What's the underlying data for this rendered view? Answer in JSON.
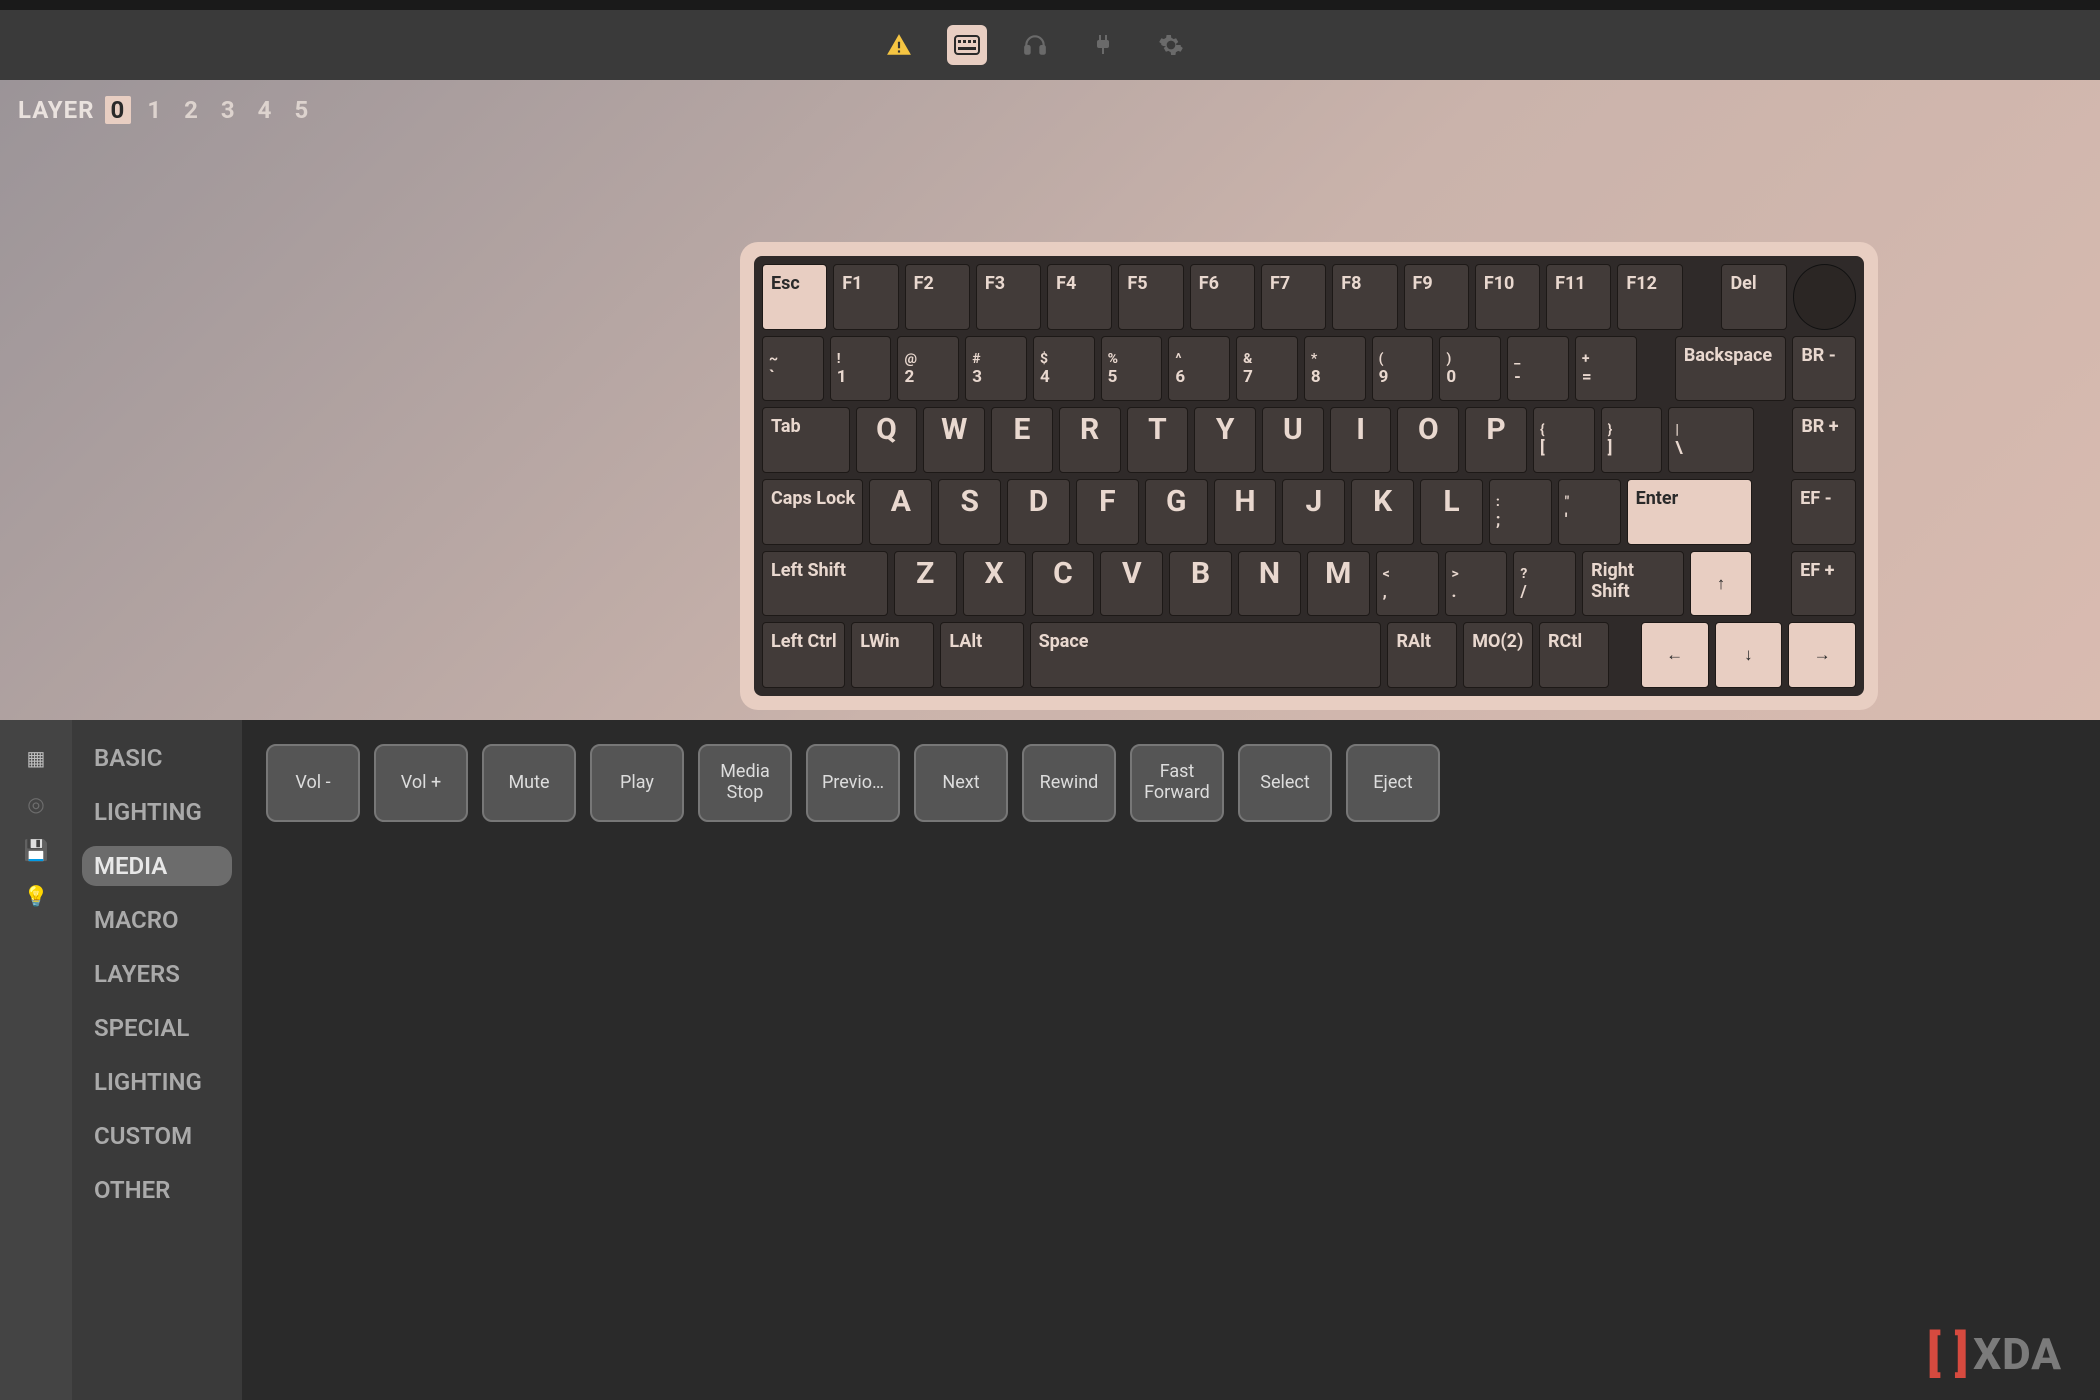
{
  "toolbar_icons": [
    "warning",
    "keyboard",
    "headset",
    "plug",
    "gear"
  ],
  "layer": {
    "label": "LAYER",
    "options": [
      "0",
      "1",
      "2",
      "3",
      "4",
      "5"
    ],
    "active": "0"
  },
  "keyboard": {
    "row0": [
      "Esc",
      "F1",
      "F2",
      "F3",
      "F4",
      "F5",
      "F6",
      "F7",
      "F8",
      "F9",
      "F10",
      "F11",
      "F12",
      "",
      "Del",
      ""
    ],
    "row1": [
      [
        "~",
        "`"
      ],
      [
        "!",
        "1"
      ],
      [
        "@",
        "2"
      ],
      [
        "#",
        "3"
      ],
      [
        "$",
        "4"
      ],
      [
        "%",
        "5"
      ],
      [
        "^",
        "6"
      ],
      [
        "&",
        "7"
      ],
      [
        "*",
        "8"
      ],
      [
        "(",
        "9"
      ],
      [
        ")",
        "0"
      ],
      [
        "_",
        "-"
      ],
      [
        "+",
        "="
      ],
      "Backspace",
      "BR -"
    ],
    "row2": [
      "Tab",
      "Q",
      "W",
      "E",
      "R",
      "T",
      "Y",
      "U",
      "I",
      "O",
      "P",
      [
        "{",
        "["
      ],
      [
        "}",
        "]"
      ],
      [
        "|",
        "\\"
      ],
      "BR +"
    ],
    "row3": [
      "Caps Lock",
      "A",
      "S",
      "D",
      "F",
      "G",
      "H",
      "J",
      "K",
      "L",
      [
        ":",
        ";"
      ],
      [
        "\"",
        "'"
      ],
      "Enter",
      "EF -"
    ],
    "row4": [
      "Left Shift",
      "Z",
      "X",
      "C",
      "V",
      "B",
      "N",
      "M",
      [
        "<",
        ","
      ],
      [
        ">",
        "."
      ],
      [
        "?",
        "/"
      ],
      "Right Shift",
      "↑",
      "EF +"
    ],
    "row5": [
      "Left Ctrl",
      "LWin",
      "LAlt",
      "Space",
      "RAlt",
      "MO(2)",
      "RCtl",
      "←",
      "↓",
      "→"
    ]
  },
  "categories": [
    "BASIC",
    "LIGHTING",
    "MEDIA",
    "MACRO",
    "LAYERS",
    "SPECIAL",
    "LIGHTING",
    "CUSTOM",
    "OTHER"
  ],
  "active_category": "MEDIA",
  "media_keys": [
    "Vol -",
    "Vol +",
    "Mute",
    "Play",
    "Media Stop",
    "Previo…",
    "Next",
    "Rewind",
    "Fast Forward",
    "Select",
    "Eject"
  ],
  "watermark": "XDA"
}
